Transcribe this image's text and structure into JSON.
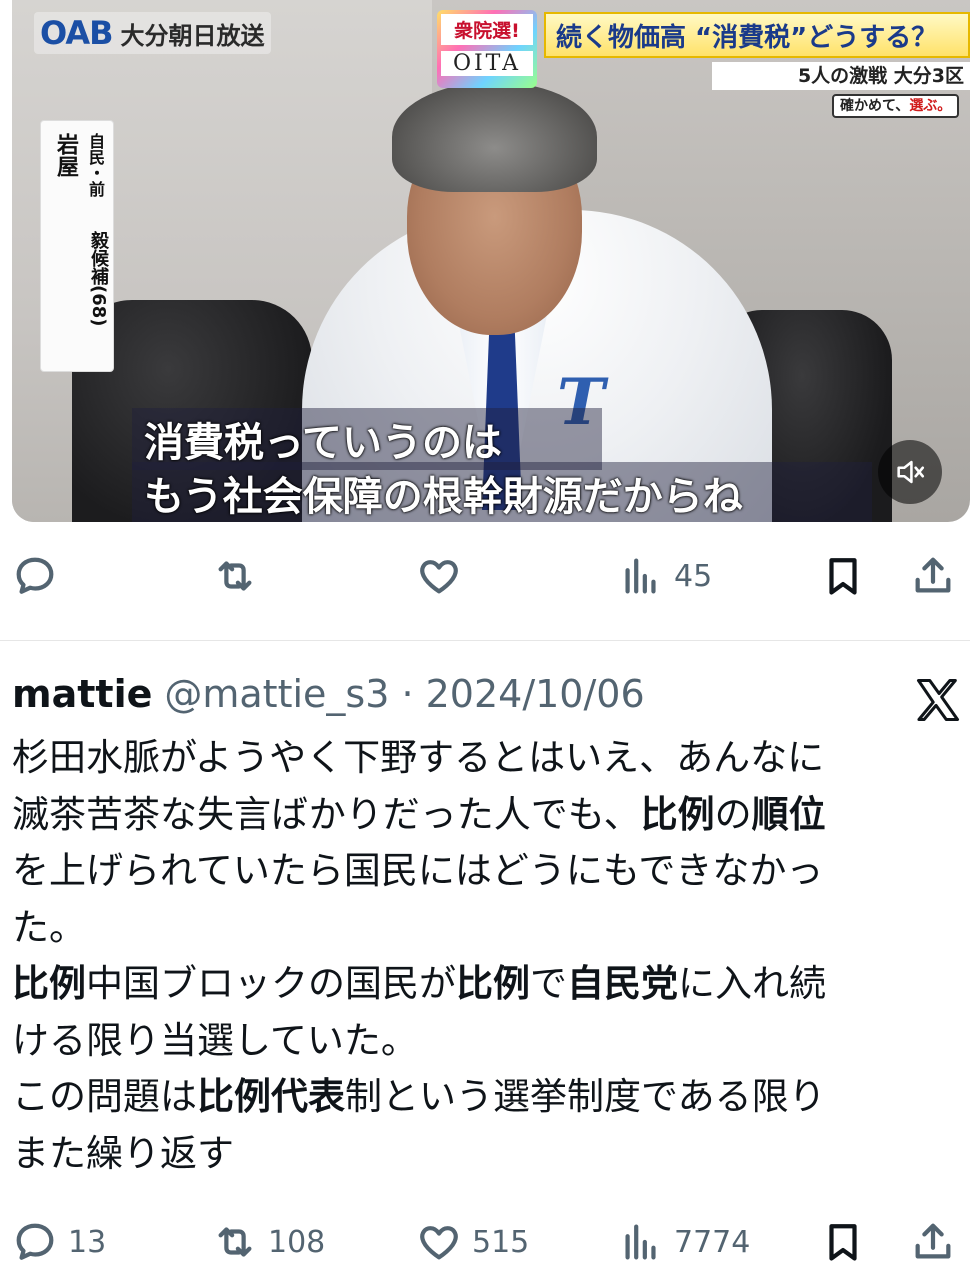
{
  "video": {
    "brand_mark": "OAB",
    "brand_name": "大分朝日放送",
    "election_tag": "衆院選!",
    "region_tag": "OITA",
    "headline": "続く物価高 “消費税”どうする？",
    "subheadline": "5人の激戦 大分3区",
    "slogan_a": "確かめて、",
    "slogan_b": "選ぶ。",
    "candidate_party": "自民・前",
    "candidate_name": "岩屋",
    "candidate_given": "毅候補(68)",
    "caption_line1": "消費税っていうのは",
    "caption_line2": "もう社会保障の根幹財源だからね",
    "mute_icon": "speaker-muted-icon"
  },
  "video_actions": {
    "reply_count": "",
    "retweet_count": "",
    "like_count": "",
    "views_count": "45"
  },
  "tweet": {
    "display_name": "mattie",
    "handle_date": "@mattie_s3 · 2024/10/06",
    "platform_icon": "x-logo-icon",
    "lines": [
      [
        {
          "t": "杉田水脈がようやく下野するとはいえ、あんなに",
          "b": false
        }
      ],
      [
        {
          "t": "滅茶苦茶な失言ばかりだった人でも、",
          "b": false
        },
        {
          "t": "比例",
          "b": true
        },
        {
          "t": "の",
          "b": false
        },
        {
          "t": "順位",
          "b": true
        }
      ],
      [
        {
          "t": "を上げられていたら国民にはどうにもできなかっ",
          "b": false
        }
      ],
      [
        {
          "t": "た。",
          "b": false
        }
      ],
      [
        {
          "t": "比例",
          "b": true
        },
        {
          "t": "中国ブロックの国民が",
          "b": false
        },
        {
          "t": "比例",
          "b": true
        },
        {
          "t": "で",
          "b": false
        },
        {
          "t": "自民党",
          "b": true
        },
        {
          "t": "に入れ続",
          "b": false
        }
      ],
      [
        {
          "t": "ける限り当選していた。",
          "b": false
        }
      ],
      [
        {
          "t": "この問題は",
          "b": false
        },
        {
          "t": "比例代表",
          "b": true
        },
        {
          "t": "制という選挙制度である限り",
          "b": false
        }
      ],
      [
        {
          "t": "また繰り返す",
          "b": false
        }
      ]
    ]
  },
  "tweet_actions": {
    "reply_count": "13",
    "retweet_count": "108",
    "like_count": "515",
    "views_count": "7774"
  }
}
